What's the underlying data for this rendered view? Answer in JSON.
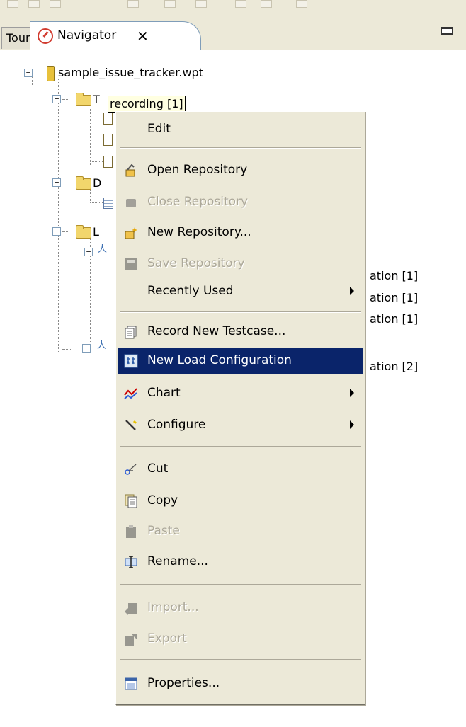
{
  "tabs": {
    "tour_label": "Tour",
    "navigator_label": "Navigator"
  },
  "tree": {
    "root_label": "sample_issue_tracker.wpt",
    "folder1_fragment": "T",
    "folder2_fragment": "D",
    "folder3_fragment": "L",
    "tooltip": "recording [1]",
    "partial_labels": [
      "ation [1]",
      "ation [1]",
      "ation [1]",
      "ation [2]"
    ]
  },
  "context_menu": {
    "items": [
      {
        "label": "Edit",
        "icon": "none",
        "enabled": true
      },
      {
        "label": "Open Repository",
        "icon": "open-repository-icon",
        "enabled": true
      },
      {
        "label": "Close Repository",
        "icon": "close-repository-icon",
        "enabled": false
      },
      {
        "label": "New Repository...",
        "icon": "new-repository-icon",
        "enabled": true
      },
      {
        "label": "Save Repository",
        "icon": "save-repository-icon",
        "enabled": false
      },
      {
        "label": "Recently Used",
        "icon": "none",
        "enabled": true,
        "submenu": true
      },
      {
        "label": "Record New Testcase...",
        "icon": "record-testcase-icon",
        "enabled": true
      },
      {
        "label": "New Load Configuration",
        "icon": "load-configuration-icon",
        "enabled": true,
        "highlighted": true
      },
      {
        "label": "Chart",
        "icon": "chart-icon",
        "enabled": true,
        "submenu": true
      },
      {
        "label": "Configure",
        "icon": "configure-icon",
        "enabled": true,
        "submenu": true
      },
      {
        "label": "Cut",
        "icon": "scissors-icon",
        "enabled": true
      },
      {
        "label": "Copy",
        "icon": "copy-icon",
        "enabled": true
      },
      {
        "label": "Paste",
        "icon": "paste-icon",
        "enabled": false
      },
      {
        "label": "Rename...",
        "icon": "rename-icon",
        "enabled": true
      },
      {
        "label": "Import...",
        "icon": "import-icon",
        "enabled": false
      },
      {
        "label": "Export",
        "icon": "export-icon",
        "enabled": false
      },
      {
        "label": "Properties...",
        "icon": "properties-icon",
        "enabled": true
      }
    ]
  },
  "colors": {
    "menu_bg": "#ece9d8",
    "highlight_bg": "#0a246a",
    "highlight_fg": "#ffffff",
    "disabled_fg": "#aca899",
    "tooltip_bg": "#ffffe1"
  }
}
